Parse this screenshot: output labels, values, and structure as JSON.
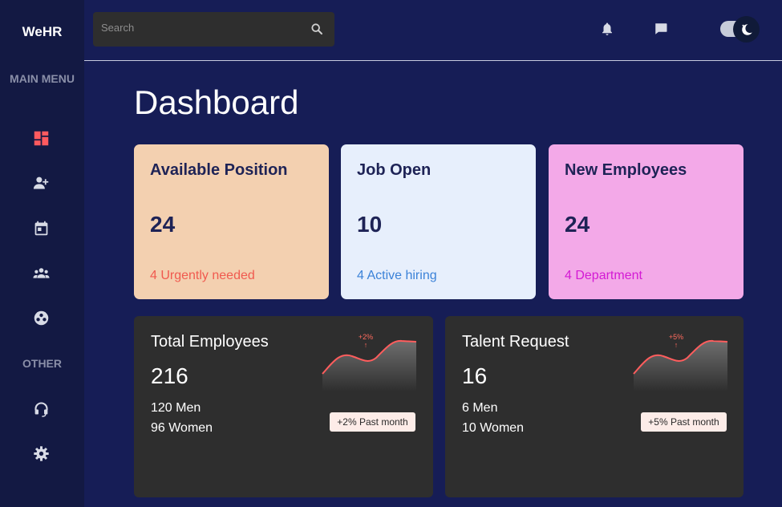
{
  "brand": {
    "logo": "WeHR"
  },
  "sidebar": {
    "main_heading": "MAIN MENU",
    "other_heading": "OTHER",
    "active_color": "#ff5a5f",
    "icons": [
      "dashboard-icon",
      "add-user-icon",
      "calendar-icon",
      "group-icon",
      "soccer-ball-icon",
      "headset-icon",
      "gear-icon"
    ]
  },
  "topbar": {
    "search_placeholder": "Search",
    "icons": [
      "search-icon",
      "bell-icon",
      "chat-icon",
      "moon-icon"
    ],
    "theme_toggle": "dark"
  },
  "page": {
    "title": "Dashboard"
  },
  "stat_cards": [
    {
      "title": "Available Position",
      "value": "24",
      "note": "4 Urgently needed",
      "bg": "#f3d0b0",
      "note_color": "#f05a4f"
    },
    {
      "title": "Job Open",
      "value": "10",
      "note": "4 Active hiring",
      "bg": "#e7effc",
      "note_color": "#3b82d8"
    },
    {
      "title": "New Employees",
      "value": "24",
      "note": "4 Department",
      "bg": "#f3a9e8",
      "note_color": "#d41ad4"
    }
  ],
  "summary_cards": [
    {
      "title": "Total Employees",
      "value": "216",
      "line1": "120 Men",
      "line2": "96 Women",
      "trend": "+2%",
      "trend_arrow": "↑",
      "badge": "+2% Past month"
    },
    {
      "title": "Talent Request",
      "value": "16",
      "line1": "6 Men",
      "line2": "10 Women",
      "trend": "+5%",
      "trend_arrow": "↑",
      "badge": "+5% Past month"
    }
  ]
}
